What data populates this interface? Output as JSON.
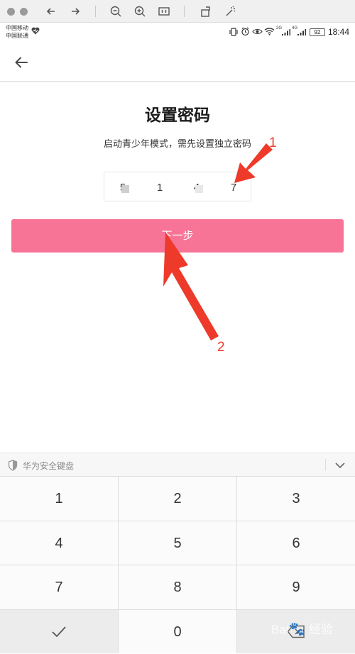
{
  "status_bar": {
    "carrier_1": "中国移动",
    "carrier_2": "中国联通",
    "net_2g": "2G",
    "net_4g": "4G",
    "battery": "92",
    "time": "18:44"
  },
  "page": {
    "title": "设置密码",
    "subtitle": "启动青少年模式，需先设置独立密码",
    "pin_digits": [
      "5",
      "1",
      "4",
      "7"
    ],
    "next_label": "下一步"
  },
  "annotations": {
    "label_1": "1",
    "label_2": "2",
    "color": "#ee3a2a"
  },
  "keyboard": {
    "title": "华为安全键盘",
    "keys": [
      "1",
      "2",
      "3",
      "4",
      "5",
      "6",
      "7",
      "8",
      "9",
      "0"
    ]
  },
  "colors": {
    "accent": "#f77497",
    "annotation": "#ee3a2a"
  }
}
